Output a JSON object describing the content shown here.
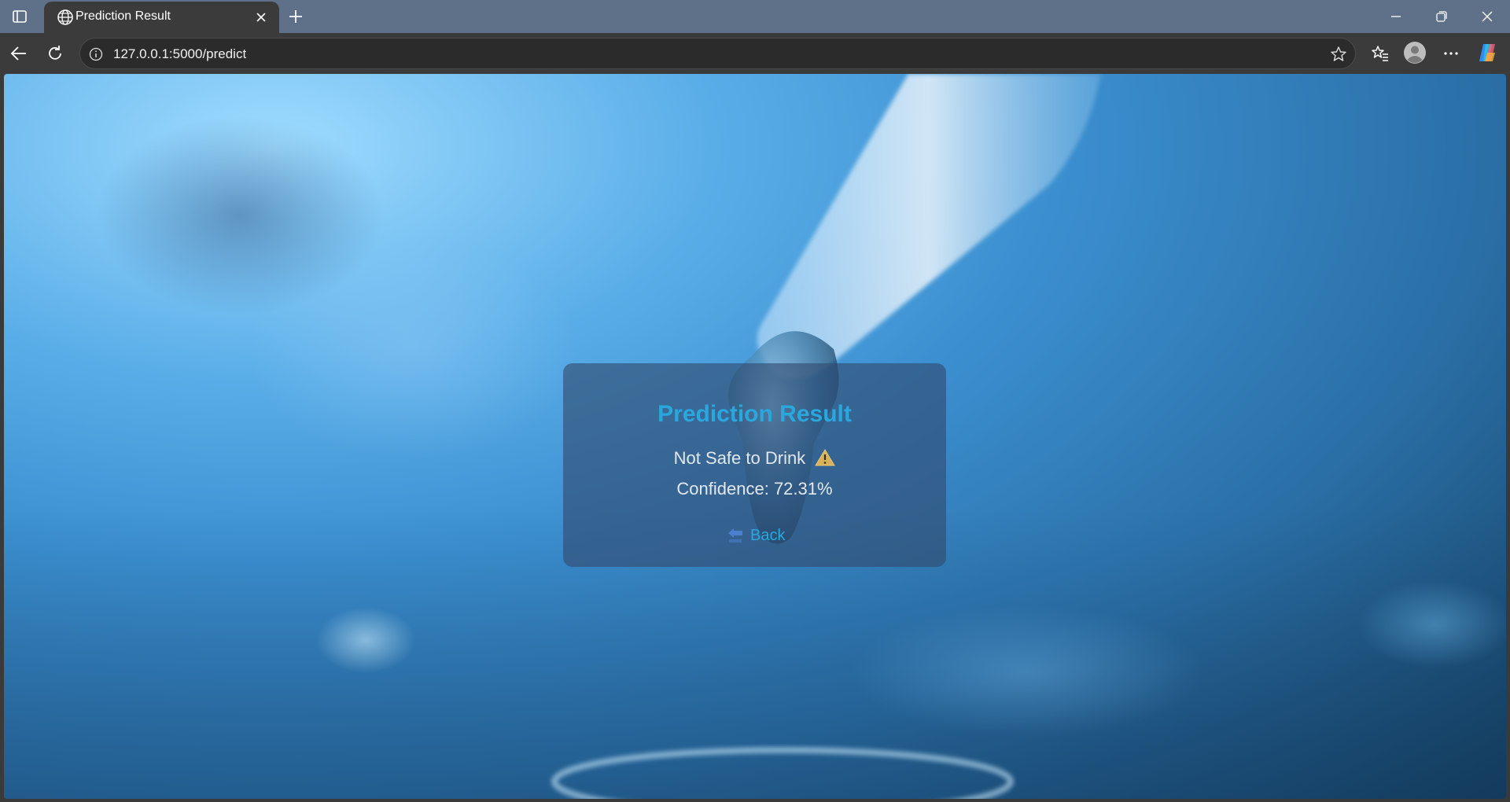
{
  "browser": {
    "tab": {
      "title": "Prediction Result",
      "favicon": "globe-icon"
    },
    "address": {
      "url": "127.0.0.1:5000/predict"
    },
    "icons": [
      "sidebar-toggle-icon",
      "close-icon",
      "plus-icon",
      "back-arrow-icon",
      "reload-icon",
      "info-icon",
      "star-icon",
      "favorites-icon",
      "profile-icon",
      "more-icon",
      "copilot-icon",
      "minimize-icon",
      "restore-icon",
      "window-close-icon"
    ]
  },
  "page": {
    "title": "Prediction Result",
    "status": "Not Safe to Drink",
    "status_icon": "warning-icon",
    "confidence": "Confidence: 72.31%",
    "back_label": "Back",
    "colors": {
      "accent": "#2aa7dc",
      "card_bg": "rgba(50,75,110,0.62)",
      "warning": "#d8b25a"
    }
  }
}
